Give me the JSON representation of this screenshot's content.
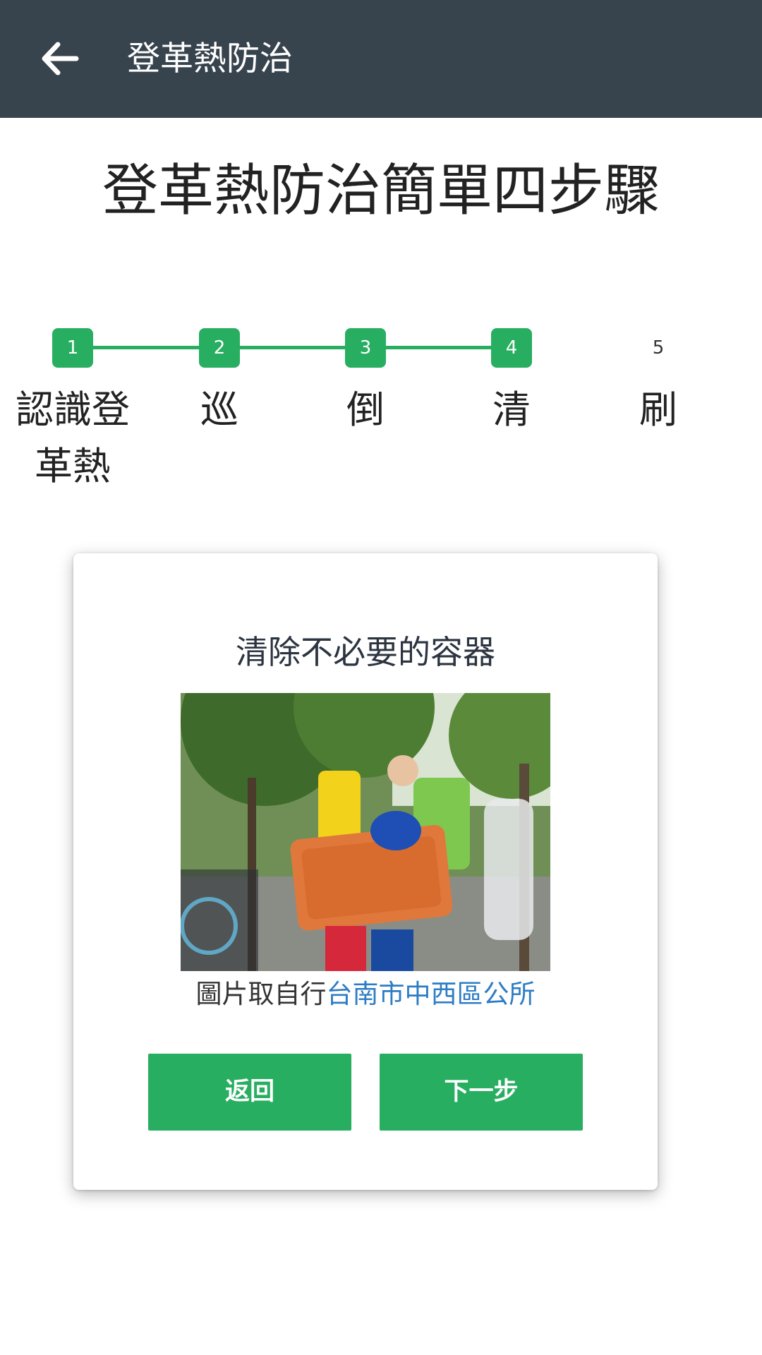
{
  "appbar": {
    "back_icon": "arrow-left-icon",
    "title": "登革熱防治"
  },
  "page": {
    "title": "登革熱防治簡單四步驟"
  },
  "stepper": {
    "accent_color": "#27ae60",
    "current_step": 4,
    "steps": [
      {
        "number": "1",
        "label": "認識登革熱",
        "done": true
      },
      {
        "number": "2",
        "label": "巡",
        "done": true
      },
      {
        "number": "3",
        "label": "倒",
        "done": true
      },
      {
        "number": "4",
        "label": "清",
        "done": true
      },
      {
        "number": "5",
        "label": "刷",
        "done": false
      }
    ]
  },
  "card": {
    "title": "清除不必要的容器",
    "image_desc": "volunteers-removing-orange-container-photo",
    "caption_prefix": "圖片取自行",
    "caption_link": "台南市中西區公所",
    "link_color": "#2e7cc4",
    "back_button": "返回",
    "next_button": "下一步"
  }
}
